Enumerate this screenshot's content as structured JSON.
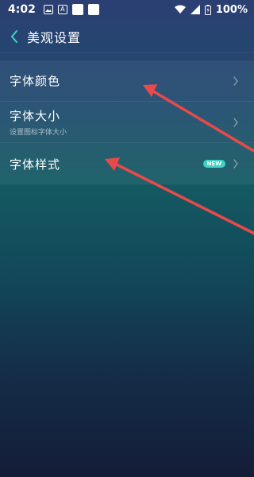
{
  "status_bar": {
    "time": "4:02",
    "battery": "100%"
  },
  "header": {
    "title": "美观设置"
  },
  "settings": {
    "items": [
      {
        "title": "字体颜色",
        "subtitle": ""
      },
      {
        "title": "字体大小",
        "subtitle": "设置图标字体大小"
      },
      {
        "title": "字体样式",
        "subtitle": "",
        "badge": "NEW"
      }
    ]
  },
  "colors": {
    "accent_badge": "#3fd3c3",
    "annotation_arrow": "#e84a4a"
  },
  "icons": {
    "back": "chevron-left-icon",
    "row_chevron": "chevron-right-icon"
  }
}
